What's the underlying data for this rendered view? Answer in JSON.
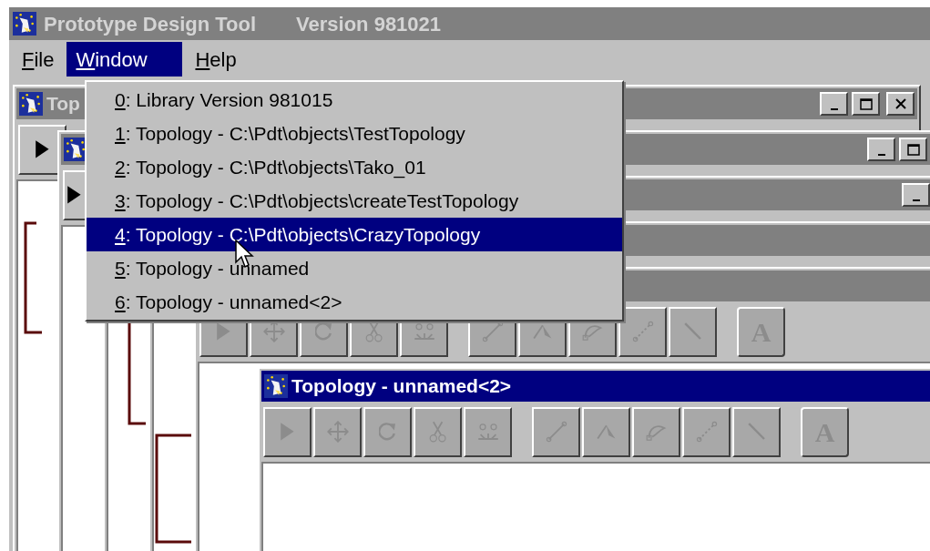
{
  "app_title_bar": {
    "title": "Prototype Design Tool",
    "version": "Version 981021"
  },
  "menu_bar": [
    {
      "mnemonic": "F",
      "rest": "ile",
      "selected": false
    },
    {
      "mnemonic": "W",
      "rest": "indow",
      "selected": true
    },
    {
      "mnemonic": "H",
      "rest": "elp",
      "selected": false
    }
  ],
  "window_menu": [
    {
      "mnemonic": "0",
      "rest": ": Library Version 981015",
      "selected": false
    },
    {
      "mnemonic": "1",
      "rest": ": Topology - C:\\Pdt\\objects\\TestTopology",
      "selected": false
    },
    {
      "mnemonic": "2",
      "rest": ": Topology - C:\\Pdt\\objects\\Tako_01",
      "selected": false
    },
    {
      "mnemonic": "3",
      "rest": ": Topology - C:\\Pdt\\objects\\createTestTopology",
      "selected": false
    },
    {
      "mnemonic": "4",
      "rest": ": Topology - C:\\Pdt\\objects\\CrazyTopology",
      "selected": true
    },
    {
      "mnemonic": "5",
      "rest": ": Topology - unnamed",
      "selected": false
    },
    {
      "mnemonic": "6",
      "rest": ": Topology - unnamed<2>",
      "selected": false
    }
  ],
  "windows": [
    {
      "title": "Top",
      "active": false,
      "tools": [
        {
          "kind": "select",
          "enabled": true
        }
      ]
    },
    {
      "active": false,
      "tools": [
        {
          "kind": "select",
          "enabled": true
        }
      ]
    },
    {
      "active": false
    },
    {
      "active": false
    },
    {
      "active": false,
      "tools": [
        {
          "kind": "select",
          "enabled": false
        },
        {
          "kind": "move",
          "enabled": false
        },
        {
          "kind": "rotate",
          "enabled": false
        },
        {
          "kind": "cut",
          "enabled": false
        },
        {
          "kind": "group",
          "enabled": false
        },
        {
          "kind": "line",
          "enabled": false
        },
        {
          "kind": "node",
          "enabled": false
        },
        {
          "kind": "edit",
          "enabled": false
        },
        {
          "kind": "link",
          "enabled": false
        },
        {
          "kind": "wand",
          "enabled": false
        },
        {
          "kind": "text",
          "enabled": false,
          "label": "A"
        }
      ]
    },
    {
      "title": "Topology - unnamed<2>",
      "active": true,
      "tools": [
        {
          "kind": "select",
          "enabled": false
        },
        {
          "kind": "move",
          "enabled": false
        },
        {
          "kind": "rotate",
          "enabled": false
        },
        {
          "kind": "cut",
          "enabled": false
        },
        {
          "kind": "group",
          "enabled": false
        },
        {
          "kind": "line",
          "enabled": false
        },
        {
          "kind": "node",
          "enabled": false
        },
        {
          "kind": "edit",
          "enabled": false
        },
        {
          "kind": "link",
          "enabled": false
        },
        {
          "kind": "wand",
          "enabled": false
        },
        {
          "kind": "text",
          "enabled": false,
          "label": "A"
        }
      ]
    }
  ]
}
